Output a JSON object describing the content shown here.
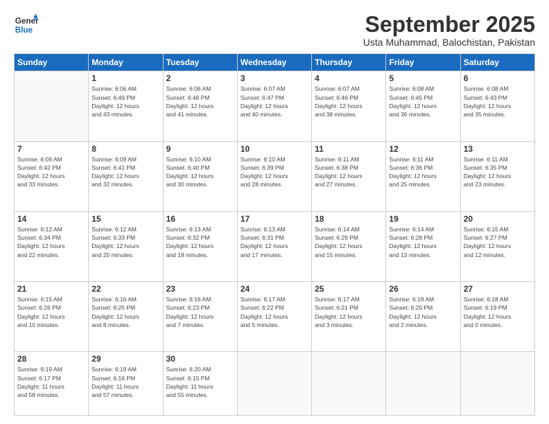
{
  "header": {
    "logo_line1": "General",
    "logo_line2": "Blue",
    "month": "September 2025",
    "location": "Usta Muhammad, Balochistan, Pakistan"
  },
  "days_of_week": [
    "Sunday",
    "Monday",
    "Tuesday",
    "Wednesday",
    "Thursday",
    "Friday",
    "Saturday"
  ],
  "weeks": [
    [
      {
        "day": "",
        "info": ""
      },
      {
        "day": "1",
        "info": "Sunrise: 6:06 AM\nSunset: 6:49 PM\nDaylight: 12 hours\nand 43 minutes."
      },
      {
        "day": "2",
        "info": "Sunrise: 6:06 AM\nSunset: 6:48 PM\nDaylight: 12 hours\nand 41 minutes."
      },
      {
        "day": "3",
        "info": "Sunrise: 6:07 AM\nSunset: 6:47 PM\nDaylight: 12 hours\nand 40 minutes."
      },
      {
        "day": "4",
        "info": "Sunrise: 6:07 AM\nSunset: 6:46 PM\nDaylight: 12 hours\nand 38 minutes."
      },
      {
        "day": "5",
        "info": "Sunrise: 6:08 AM\nSunset: 6:45 PM\nDaylight: 12 hours\nand 36 minutes."
      },
      {
        "day": "6",
        "info": "Sunrise: 6:08 AM\nSunset: 6:43 PM\nDaylight: 12 hours\nand 35 minutes."
      }
    ],
    [
      {
        "day": "7",
        "info": "Sunrise: 6:09 AM\nSunset: 6:42 PM\nDaylight: 12 hours\nand 33 minutes."
      },
      {
        "day": "8",
        "info": "Sunrise: 6:09 AM\nSunset: 6:41 PM\nDaylight: 12 hours\nand 32 minutes."
      },
      {
        "day": "9",
        "info": "Sunrise: 6:10 AM\nSunset: 6:40 PM\nDaylight: 12 hours\nand 30 minutes."
      },
      {
        "day": "10",
        "info": "Sunrise: 6:10 AM\nSunset: 6:39 PM\nDaylight: 12 hours\nand 28 minutes."
      },
      {
        "day": "11",
        "info": "Sunrise: 6:11 AM\nSunset: 6:38 PM\nDaylight: 12 hours\nand 27 minutes."
      },
      {
        "day": "12",
        "info": "Sunrise: 6:11 AM\nSunset: 6:36 PM\nDaylight: 12 hours\nand 25 minutes."
      },
      {
        "day": "13",
        "info": "Sunrise: 6:11 AM\nSunset: 6:35 PM\nDaylight: 12 hours\nand 23 minutes."
      }
    ],
    [
      {
        "day": "14",
        "info": "Sunrise: 6:12 AM\nSunset: 6:34 PM\nDaylight: 12 hours\nand 22 minutes."
      },
      {
        "day": "15",
        "info": "Sunrise: 6:12 AM\nSunset: 6:33 PM\nDaylight: 12 hours\nand 20 minutes."
      },
      {
        "day": "16",
        "info": "Sunrise: 6:13 AM\nSunset: 6:32 PM\nDaylight: 12 hours\nand 18 minutes."
      },
      {
        "day": "17",
        "info": "Sunrise: 6:13 AM\nSunset: 6:31 PM\nDaylight: 12 hours\nand 17 minutes."
      },
      {
        "day": "18",
        "info": "Sunrise: 6:14 AM\nSunset: 6:29 PM\nDaylight: 12 hours\nand 15 minutes."
      },
      {
        "day": "19",
        "info": "Sunrise: 6:14 AM\nSunset: 6:28 PM\nDaylight: 12 hours\nand 13 minutes."
      },
      {
        "day": "20",
        "info": "Sunrise: 6:15 AM\nSunset: 6:27 PM\nDaylight: 12 hours\nand 12 minutes."
      }
    ],
    [
      {
        "day": "21",
        "info": "Sunrise: 6:15 AM\nSunset: 6:26 PM\nDaylight: 12 hours\nand 10 minutes."
      },
      {
        "day": "22",
        "info": "Sunrise: 6:16 AM\nSunset: 6:25 PM\nDaylight: 12 hours\nand 8 minutes."
      },
      {
        "day": "23",
        "info": "Sunrise: 6:16 AM\nSunset: 6:23 PM\nDaylight: 12 hours\nand 7 minutes."
      },
      {
        "day": "24",
        "info": "Sunrise: 6:17 AM\nSunset: 6:22 PM\nDaylight: 12 hours\nand 5 minutes."
      },
      {
        "day": "25",
        "info": "Sunrise: 6:17 AM\nSunset: 6:21 PM\nDaylight: 12 hours\nand 3 minutes."
      },
      {
        "day": "26",
        "info": "Sunrise: 6:18 AM\nSunset: 6:20 PM\nDaylight: 12 hours\nand 2 minutes."
      },
      {
        "day": "27",
        "info": "Sunrise: 6:18 AM\nSunset: 6:19 PM\nDaylight: 12 hours\nand 0 minutes."
      }
    ],
    [
      {
        "day": "28",
        "info": "Sunrise: 6:19 AM\nSunset: 6:17 PM\nDaylight: 11 hours\nand 58 minutes."
      },
      {
        "day": "29",
        "info": "Sunrise: 6:19 AM\nSunset: 6:16 PM\nDaylight: 11 hours\nand 57 minutes."
      },
      {
        "day": "30",
        "info": "Sunrise: 6:20 AM\nSunset: 6:15 PM\nDaylight: 11 hours\nand 55 minutes."
      },
      {
        "day": "",
        "info": ""
      },
      {
        "day": "",
        "info": ""
      },
      {
        "day": "",
        "info": ""
      },
      {
        "day": "",
        "info": ""
      }
    ]
  ]
}
